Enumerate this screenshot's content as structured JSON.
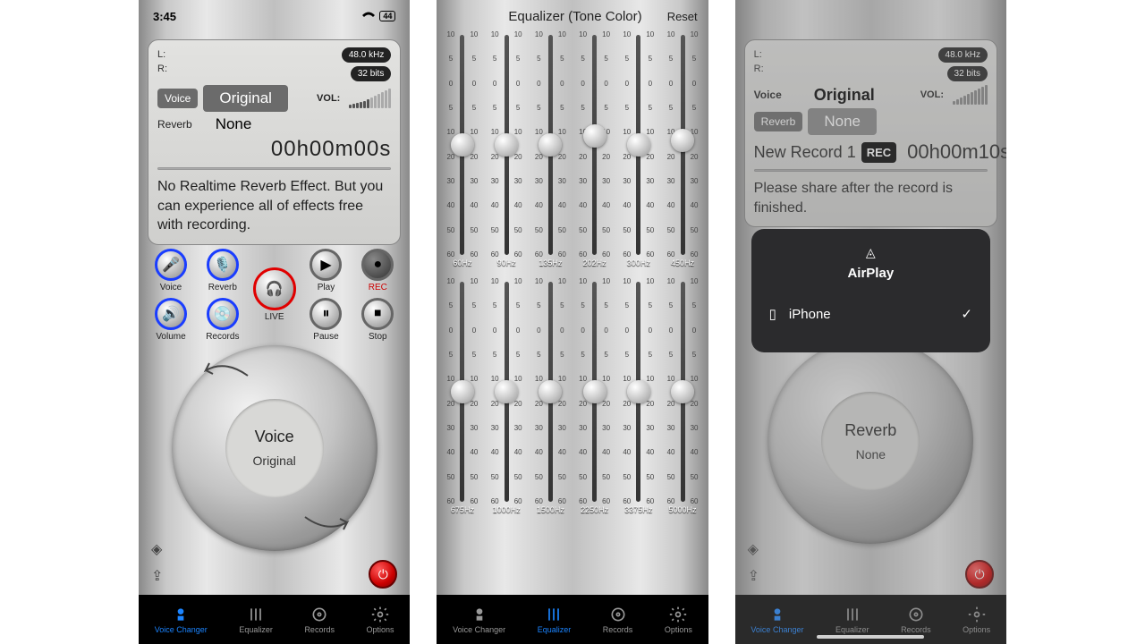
{
  "status": {
    "time": "3:45",
    "battery": "44"
  },
  "sample": {
    "rate": "48.0 kHz",
    "bits": "32 bits"
  },
  "labels": {
    "L": "L:",
    "R": "R:",
    "voice": "Voice",
    "reverb": "Reverb",
    "vol": "VOL:"
  },
  "screen1": {
    "voice_value": "Original",
    "reverb_value": "None",
    "timer": "00h00m00s",
    "message": "No Realtime Reverb Effect. But you can experience all of effects free with recording.",
    "buttons": {
      "voice": "Voice",
      "reverb": "Reverb",
      "volume": "Volume",
      "records": "Records",
      "live": "LIVE",
      "play": "Play",
      "rec": "REC",
      "pause": "Pause",
      "stop": "Stop"
    },
    "wheel": {
      "title": "Voice",
      "sub": "Original"
    }
  },
  "screen2": {
    "title": "Equalizer (Tone Color)",
    "reset": "Reset",
    "ticks": [
      "10",
      "5",
      "0",
      "5",
      "10",
      "20",
      "30",
      "40",
      "50",
      "60"
    ],
    "row1": [
      "60Hz",
      "90Hz",
      "135Hz",
      "202Hz",
      "300Hz",
      "450Hz"
    ],
    "row2": [
      "675Hz",
      "1000Hz",
      "1500Hz",
      "2250Hz",
      "3375Hz",
      "5000Hz"
    ],
    "knob_row1": [
      50,
      50,
      50,
      46,
      50,
      48
    ],
    "knob_row2": [
      50,
      50,
      50,
      50,
      50,
      50
    ]
  },
  "screen3": {
    "voice_value": "Original",
    "reverb_value": "None",
    "rec_name": "New Record 1",
    "rec_badge": "REC",
    "timer": "00h00m10s",
    "message": "Please share after the record is finished.",
    "wheel": {
      "title": "Reverb",
      "sub": "None"
    },
    "airplay": {
      "title": "AirPlay",
      "device": "iPhone"
    }
  },
  "tabs": {
    "vc": "Voice Changer",
    "eq": "Equalizer",
    "rec": "Records",
    "opt": "Options"
  }
}
